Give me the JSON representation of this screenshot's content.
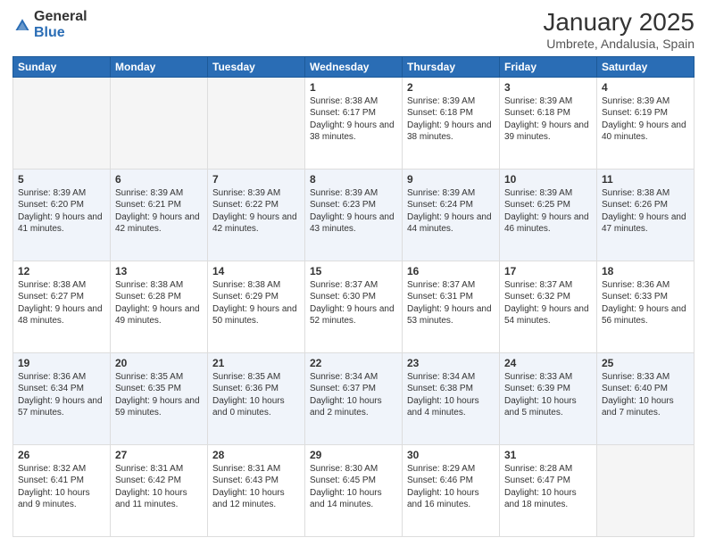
{
  "logo": {
    "general": "General",
    "blue": "Blue"
  },
  "title": {
    "main": "January 2025",
    "sub": "Umbrete, Andalusia, Spain"
  },
  "days_of_week": [
    "Sunday",
    "Monday",
    "Tuesday",
    "Wednesday",
    "Thursday",
    "Friday",
    "Saturday"
  ],
  "weeks": [
    [
      {
        "day": "",
        "info": ""
      },
      {
        "day": "",
        "info": ""
      },
      {
        "day": "",
        "info": ""
      },
      {
        "day": "1",
        "info": "Sunrise: 8:38 AM\nSunset: 6:17 PM\nDaylight: 9 hours\nand 38 minutes."
      },
      {
        "day": "2",
        "info": "Sunrise: 8:39 AM\nSunset: 6:18 PM\nDaylight: 9 hours\nand 38 minutes."
      },
      {
        "day": "3",
        "info": "Sunrise: 8:39 AM\nSunset: 6:18 PM\nDaylight: 9 hours\nand 39 minutes."
      },
      {
        "day": "4",
        "info": "Sunrise: 8:39 AM\nSunset: 6:19 PM\nDaylight: 9 hours\nand 40 minutes."
      }
    ],
    [
      {
        "day": "5",
        "info": "Sunrise: 8:39 AM\nSunset: 6:20 PM\nDaylight: 9 hours\nand 41 minutes."
      },
      {
        "day": "6",
        "info": "Sunrise: 8:39 AM\nSunset: 6:21 PM\nDaylight: 9 hours\nand 42 minutes."
      },
      {
        "day": "7",
        "info": "Sunrise: 8:39 AM\nSunset: 6:22 PM\nDaylight: 9 hours\nand 42 minutes."
      },
      {
        "day": "8",
        "info": "Sunrise: 8:39 AM\nSunset: 6:23 PM\nDaylight: 9 hours\nand 43 minutes."
      },
      {
        "day": "9",
        "info": "Sunrise: 8:39 AM\nSunset: 6:24 PM\nDaylight: 9 hours\nand 44 minutes."
      },
      {
        "day": "10",
        "info": "Sunrise: 8:39 AM\nSunset: 6:25 PM\nDaylight: 9 hours\nand 46 minutes."
      },
      {
        "day": "11",
        "info": "Sunrise: 8:38 AM\nSunset: 6:26 PM\nDaylight: 9 hours\nand 47 minutes."
      }
    ],
    [
      {
        "day": "12",
        "info": "Sunrise: 8:38 AM\nSunset: 6:27 PM\nDaylight: 9 hours\nand 48 minutes."
      },
      {
        "day": "13",
        "info": "Sunrise: 8:38 AM\nSunset: 6:28 PM\nDaylight: 9 hours\nand 49 minutes."
      },
      {
        "day": "14",
        "info": "Sunrise: 8:38 AM\nSunset: 6:29 PM\nDaylight: 9 hours\nand 50 minutes."
      },
      {
        "day": "15",
        "info": "Sunrise: 8:37 AM\nSunset: 6:30 PM\nDaylight: 9 hours\nand 52 minutes."
      },
      {
        "day": "16",
        "info": "Sunrise: 8:37 AM\nSunset: 6:31 PM\nDaylight: 9 hours\nand 53 minutes."
      },
      {
        "day": "17",
        "info": "Sunrise: 8:37 AM\nSunset: 6:32 PM\nDaylight: 9 hours\nand 54 minutes."
      },
      {
        "day": "18",
        "info": "Sunrise: 8:36 AM\nSunset: 6:33 PM\nDaylight: 9 hours\nand 56 minutes."
      }
    ],
    [
      {
        "day": "19",
        "info": "Sunrise: 8:36 AM\nSunset: 6:34 PM\nDaylight: 9 hours\nand 57 minutes."
      },
      {
        "day": "20",
        "info": "Sunrise: 8:35 AM\nSunset: 6:35 PM\nDaylight: 9 hours\nand 59 minutes."
      },
      {
        "day": "21",
        "info": "Sunrise: 8:35 AM\nSunset: 6:36 PM\nDaylight: 10 hours\nand 0 minutes."
      },
      {
        "day": "22",
        "info": "Sunrise: 8:34 AM\nSunset: 6:37 PM\nDaylight: 10 hours\nand 2 minutes."
      },
      {
        "day": "23",
        "info": "Sunrise: 8:34 AM\nSunset: 6:38 PM\nDaylight: 10 hours\nand 4 minutes."
      },
      {
        "day": "24",
        "info": "Sunrise: 8:33 AM\nSunset: 6:39 PM\nDaylight: 10 hours\nand 5 minutes."
      },
      {
        "day": "25",
        "info": "Sunrise: 8:33 AM\nSunset: 6:40 PM\nDaylight: 10 hours\nand 7 minutes."
      }
    ],
    [
      {
        "day": "26",
        "info": "Sunrise: 8:32 AM\nSunset: 6:41 PM\nDaylight: 10 hours\nand 9 minutes."
      },
      {
        "day": "27",
        "info": "Sunrise: 8:31 AM\nSunset: 6:42 PM\nDaylight: 10 hours\nand 11 minutes."
      },
      {
        "day": "28",
        "info": "Sunrise: 8:31 AM\nSunset: 6:43 PM\nDaylight: 10 hours\nand 12 minutes."
      },
      {
        "day": "29",
        "info": "Sunrise: 8:30 AM\nSunset: 6:45 PM\nDaylight: 10 hours\nand 14 minutes."
      },
      {
        "day": "30",
        "info": "Sunrise: 8:29 AM\nSunset: 6:46 PM\nDaylight: 10 hours\nand 16 minutes."
      },
      {
        "day": "31",
        "info": "Sunrise: 8:28 AM\nSunset: 6:47 PM\nDaylight: 10 hours\nand 18 minutes."
      },
      {
        "day": "",
        "info": ""
      }
    ]
  ]
}
